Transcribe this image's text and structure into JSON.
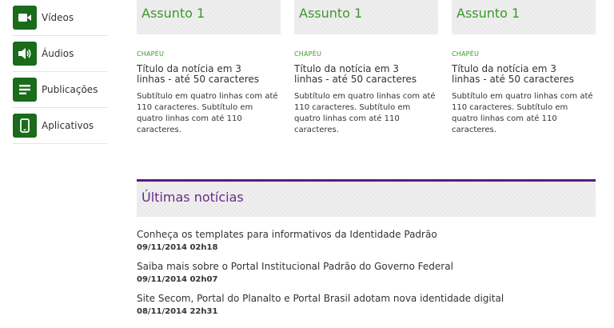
{
  "sidebar": {
    "items": [
      {
        "label": "Vídeos",
        "icon": "video-icon"
      },
      {
        "label": "Áudios",
        "icon": "audio-icon"
      },
      {
        "label": "Publicações",
        "icon": "publications-icon"
      },
      {
        "label": "Aplicativos",
        "icon": "smartphone-icon"
      }
    ]
  },
  "featured": {
    "cards": [
      {
        "subject": "Assunto 1",
        "tag": "CHAPÉU",
        "title": "Título da notícia em 3 linhas - até 50 caracteres",
        "subtitle": "Subtítulo em quatro linhas com até 110 caracteres. Subtítulo em quatro linhas com até 110 caracteres."
      },
      {
        "subject": "Assunto 1",
        "tag": "CHAPÉU",
        "title": "Título da notícia em 3 linhas - até 50 caracteres",
        "subtitle": "Subtítulo em quatro linhas com até 110 caracteres. Subtítulo em quatro linhas com até 110 caracteres."
      },
      {
        "subject": "Assunto 1",
        "tag": "CHAPÉU",
        "title": "Título da notícia em 3 linhas - até 50 caracteres",
        "subtitle": "Subtítulo em quatro linhas com até 110 caracteres. Subtítulo em quatro linhas com até 110 caracteres."
      }
    ]
  },
  "latest_news": {
    "title": "Últimas notícias",
    "items": [
      {
        "text": "Conheça os templates para informativos da Identidade Padrão",
        "date": "09/11/2014 02h18"
      },
      {
        "text": "Saiba mais sobre o Portal Institucional Padrão do Governo Federal",
        "date": "09/11/2014 02h07"
      },
      {
        "text": "Site Secom, Portal do Planalto e Portal Brasil adotam nova identidade digital",
        "date": "08/11/2014 22h31"
      }
    ]
  },
  "colors": {
    "icon_bg": "#1a6b1a",
    "subject_green": "#3a9a2a",
    "news_accent": "#5a1a82"
  }
}
